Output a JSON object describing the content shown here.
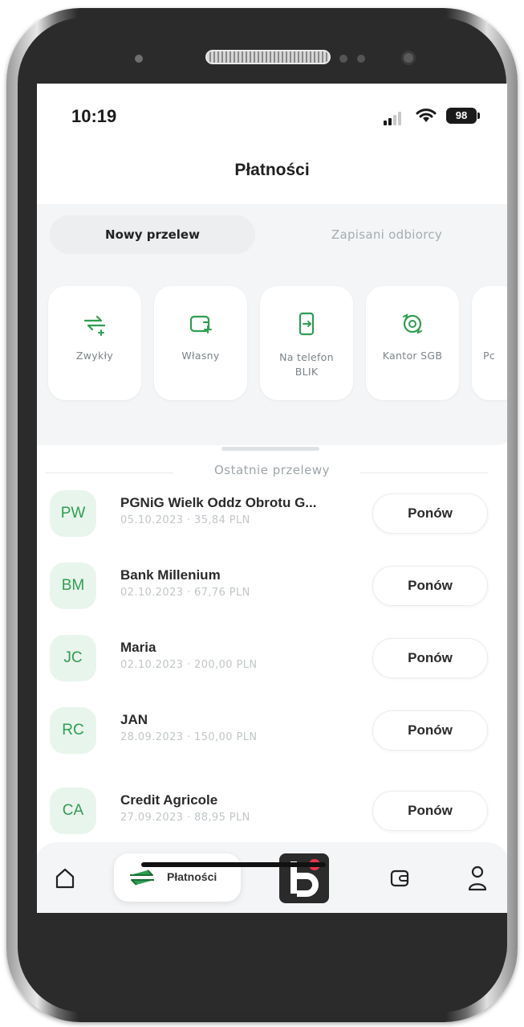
{
  "status_bar": {
    "time": "10:19",
    "battery": "98"
  },
  "header": {
    "title": "Płatności"
  },
  "tabs": [
    {
      "label": "Nowy przelew",
      "active": true
    },
    {
      "label": "Zapisani odbiorcy",
      "active": false
    }
  ],
  "transfer_types": [
    {
      "label": "Zwykły",
      "icon": "arrows-exchange-icon"
    },
    {
      "label": "Własny",
      "icon": "wallet-plus-icon"
    },
    {
      "label": "Na telefon\nBLIK",
      "icon": "phone-transfer-icon"
    },
    {
      "label": "Kantor SGB",
      "icon": "currency-exchange-icon"
    },
    {
      "label": "Pc",
      "icon": "more-icon"
    }
  ],
  "recent_transfers": {
    "title": "Ostatnie przelewy",
    "items": [
      {
        "initials": "PW",
        "name": "PGNiG Wielk Oddz Obrotu G...",
        "meta": "05.10.2023 · 35,84 PLN",
        "action": "Ponów"
      },
      {
        "initials": "BM",
        "name": "Bank Millenium",
        "meta": "02.10.2023 · 67,76 PLN",
        "action": "Ponów"
      },
      {
        "initials": "JC",
        "name": "Maria",
        "meta": "02.10.2023 · 200,00 PLN",
        "action": "Ponów"
      },
      {
        "initials": "RC",
        "name": "JAN",
        "meta": "28.09.2023 · 150,00 PLN",
        "action": "Ponów"
      },
      {
        "initials": "CA",
        "name": "Credit Agricole",
        "meta": "27.09.2023 · 88,95 PLN",
        "action": "Ponów"
      }
    ]
  },
  "bottom_nav": {
    "home_icon": "home-icon",
    "payments_label": "Płatności",
    "payments_icon": "arrows-exchange-icon",
    "brand_icon": "bank-logo-icon",
    "wallet_icon": "wallet-icon",
    "profile_icon": "user-icon"
  },
  "colors": {
    "accent_green": "#2e9e52",
    "brand_red": "#e8344e",
    "panel_bg": "#f3f5f6"
  }
}
